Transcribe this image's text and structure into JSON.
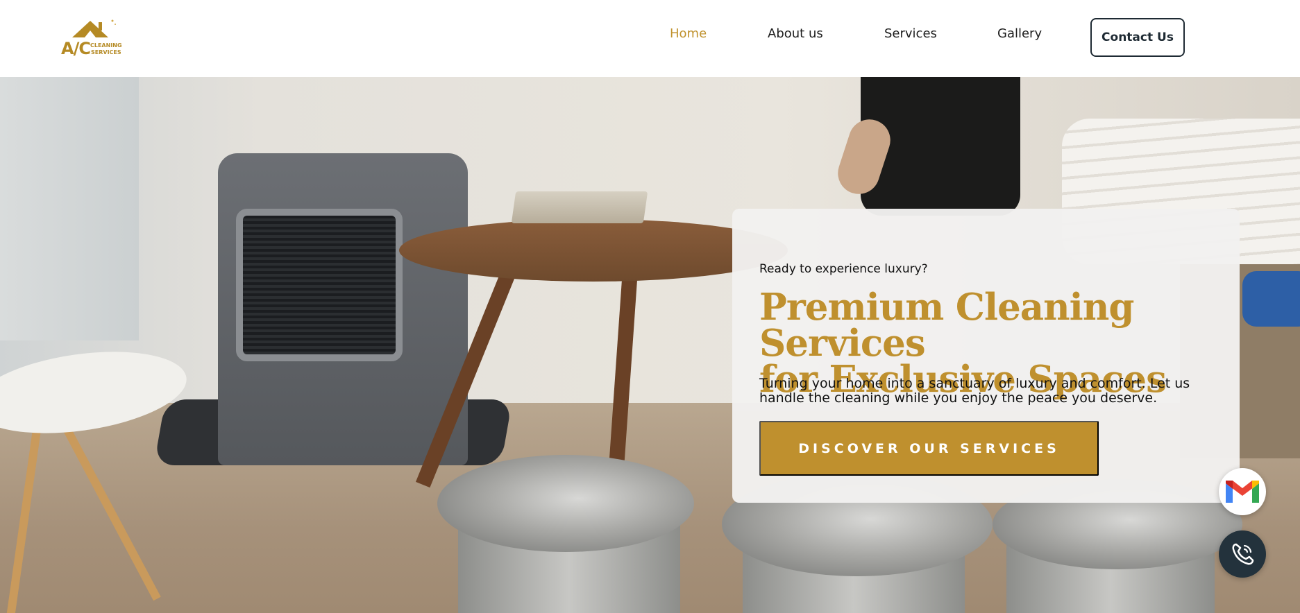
{
  "logo": {
    "big_text": "A/C",
    "small_line1": "CLEANING",
    "small_line2": "SERVICES",
    "icon": "house-logo-icon"
  },
  "nav": {
    "items": [
      {
        "label": "Home",
        "active": true
      },
      {
        "label": "About us",
        "active": false
      },
      {
        "label": "Services",
        "active": false
      },
      {
        "label": "Gallery",
        "active": false
      }
    ],
    "contact_label": "Contact Us"
  },
  "hero": {
    "eyebrow": "Ready to experience luxury?",
    "headline_line1": "Premium Cleaning Services",
    "headline_line2": "for Exclusive Spaces",
    "description": "Turning your home into a sanctuary of luxury and comfort. Let us handle the cleaning while you enjoy the peace you deserve.",
    "cta_label": "DISCOVER OUR SERVICES"
  },
  "floating": {
    "email_icon": "gmail-icon",
    "phone_icon": "phone-icon"
  },
  "colors": {
    "accent": "#bf902e",
    "active_nav": "#c0922e",
    "dark": "#1e2a33",
    "phone_fab": "#23323c"
  }
}
